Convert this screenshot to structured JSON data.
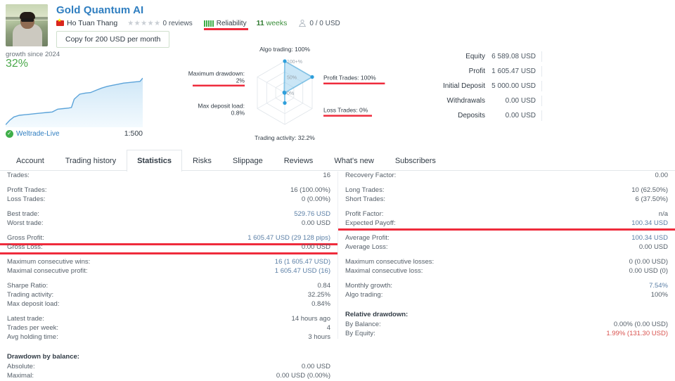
{
  "header": {
    "title": "Gold Quantum AI",
    "author": "Ho Tuan Thang",
    "stars": "★★★★★",
    "reviews": "0 reviews",
    "reliability_label": "Reliability",
    "reliability_bars": 5,
    "weeks_num": "11",
    "weeks_label": "weeks",
    "subscribers": "0 / 0 USD",
    "copy_button": "Copy for 200 USD per month",
    "avatar_name": "user-avatar-photo"
  },
  "growth": {
    "label": "growth since 2024",
    "value": "32%",
    "broker": "Weltrade-Live",
    "leverage": "1:500"
  },
  "colors": {
    "accent_blue": "#2f7ec0",
    "bar_blue": "#5bade8",
    "bar_blue_light": "#b9ddf5",
    "green": "#4aa84a",
    "red_highlight": "#ef2b3c",
    "radar_line": "#2f9fdb"
  },
  "chart_data": [
    {
      "type": "area",
      "title": "growth since 2024",
      "ylabel": "",
      "xlabel": "",
      "annotation": "32%",
      "x": [
        0,
        3,
        6,
        10,
        14,
        18,
        22,
        26,
        30,
        34,
        38,
        42,
        46,
        48,
        50,
        54,
        58,
        62,
        66,
        70,
        74,
        78,
        82,
        86,
        90,
        94,
        98,
        100
      ],
      "y": [
        2,
        10,
        16,
        19,
        20,
        21,
        22,
        23,
        24,
        25,
        30,
        31,
        32,
        33,
        48,
        57,
        59,
        60,
        64,
        68,
        71,
        73,
        75,
        77,
        78,
        79,
        80,
        86
      ],
      "ylim": [
        0,
        100
      ],
      "grid": false
    },
    {
      "type": "radar",
      "title": "Trading metrics radar",
      "axis_ticks": [
        "0%",
        "50%",
        "100+%"
      ],
      "categories": [
        "Algo trading: 100%",
        "Profit Trades: 100%",
        "Loss Trades: 0%",
        "Trading activity: 32.2%",
        "Max deposit load: 0.8%",
        "Maximum drawdown: 2%"
      ],
      "values": [
        100,
        100,
        0,
        32.2,
        0.8,
        2
      ],
      "underlined_labels": [
        "Profit Trades: 100%",
        "Loss Trades: 0%",
        "Maximum drawdown: 2%"
      ]
    },
    {
      "type": "bar",
      "title": "Account balances",
      "orientation": "horizontal",
      "categories": [
        "Equity",
        "Profit",
        "Initial Deposit",
        "Withdrawals",
        "Deposits"
      ],
      "value_labels": [
        "6 589.08 USD",
        "1 605.47 USD",
        "5 000.00 USD",
        "0.00 USD",
        "0.00 USD"
      ],
      "values": [
        6589.08,
        1605.47,
        5000.0,
        0.0,
        0.0
      ],
      "bar_colors": [
        "#5bade8",
        "#b9ddf5",
        "#5bade8",
        "#b9ddf5",
        "#b9ddf5"
      ],
      "xlim": [
        0,
        6589.08
      ],
      "grid": false,
      "legend": "none"
    }
  ],
  "tabs": [
    {
      "label": "Account",
      "active": false
    },
    {
      "label": "Trading history",
      "active": false
    },
    {
      "label": "Statistics",
      "active": true
    },
    {
      "label": "Risks",
      "active": false
    },
    {
      "label": "Slippage",
      "active": false
    },
    {
      "label": "Reviews",
      "active": false
    },
    {
      "label": "What's new",
      "active": false
    },
    {
      "label": "Subscribers",
      "active": false
    }
  ],
  "stats_left": [
    {
      "k": "Trades:",
      "v": "16"
    },
    {
      "k": "Profit Trades:",
      "v": "16 (100.00%)"
    },
    {
      "k": "Loss Trades:",
      "v": "0 (0.00%)"
    },
    {
      "k": "Best trade:",
      "v": "529.76 USD",
      "style": "blue"
    },
    {
      "k": "Worst trade:",
      "v": "0.00 USD"
    },
    {
      "k": "Gross Profit:",
      "v": "1 605.47 USD (29 128 pips)",
      "style": "blue"
    },
    {
      "k": "Gross Loss:",
      "v": "0.00 USD"
    },
    {
      "k": "Maximum consecutive wins:",
      "v": "16 (1 605.47 USD)",
      "style": "blue"
    },
    {
      "k": "Maximal consecutive profit:",
      "v": "1 605.47 USD (16)",
      "style": "blue"
    },
    {
      "k": "Sharpe Ratio:",
      "v": "0.84"
    },
    {
      "k": "Trading activity:",
      "v": "32.25%"
    },
    {
      "k": "Max deposit load:",
      "v": "0.84%"
    },
    {
      "k": "Latest trade:",
      "v": "14 hours ago"
    },
    {
      "k": "Trades per week:",
      "v": "4"
    },
    {
      "k": "Avg holding time:",
      "v": "3 hours"
    }
  ],
  "stats_right": [
    {
      "k": "Recovery Factor:",
      "v": "0.00"
    },
    {
      "k": "Long Trades:",
      "v": "10 (62.50%)"
    },
    {
      "k": "Short Trades:",
      "v": "6 (37.50%)"
    },
    {
      "k": "Profit Factor:",
      "v": "n/a"
    },
    {
      "k": "Expected Payoff:",
      "v": "100.34 USD",
      "style": "blue"
    },
    {
      "k": "Average Profit:",
      "v": "100.34 USD",
      "style": "blue"
    },
    {
      "k": "Average Loss:",
      "v": "0.00 USD"
    },
    {
      "k": "Maximum consecutive losses:",
      "v": "0 (0.00 USD)"
    },
    {
      "k": "Maximal consecutive loss:",
      "v": "0.00 USD (0)"
    },
    {
      "k": "Monthly growth:",
      "v": "7.54%",
      "style": "blue"
    },
    {
      "k": "Algo trading:",
      "v": "100%"
    }
  ],
  "drawdown_left": {
    "head": "Drawdown by balance:",
    "rows": [
      {
        "k": "Absolute:",
        "v": "0.00 USD"
      },
      {
        "k": "Maximal:",
        "v": "0.00 USD (0.00%)"
      }
    ]
  },
  "drawdown_right": {
    "head": "Relative drawdown:",
    "rows": [
      {
        "k": "By Balance:",
        "v": "0.00% (0.00 USD)"
      },
      {
        "k": "By Equity:",
        "v": "1.99% (131.30 USD)",
        "style": "red"
      }
    ]
  }
}
